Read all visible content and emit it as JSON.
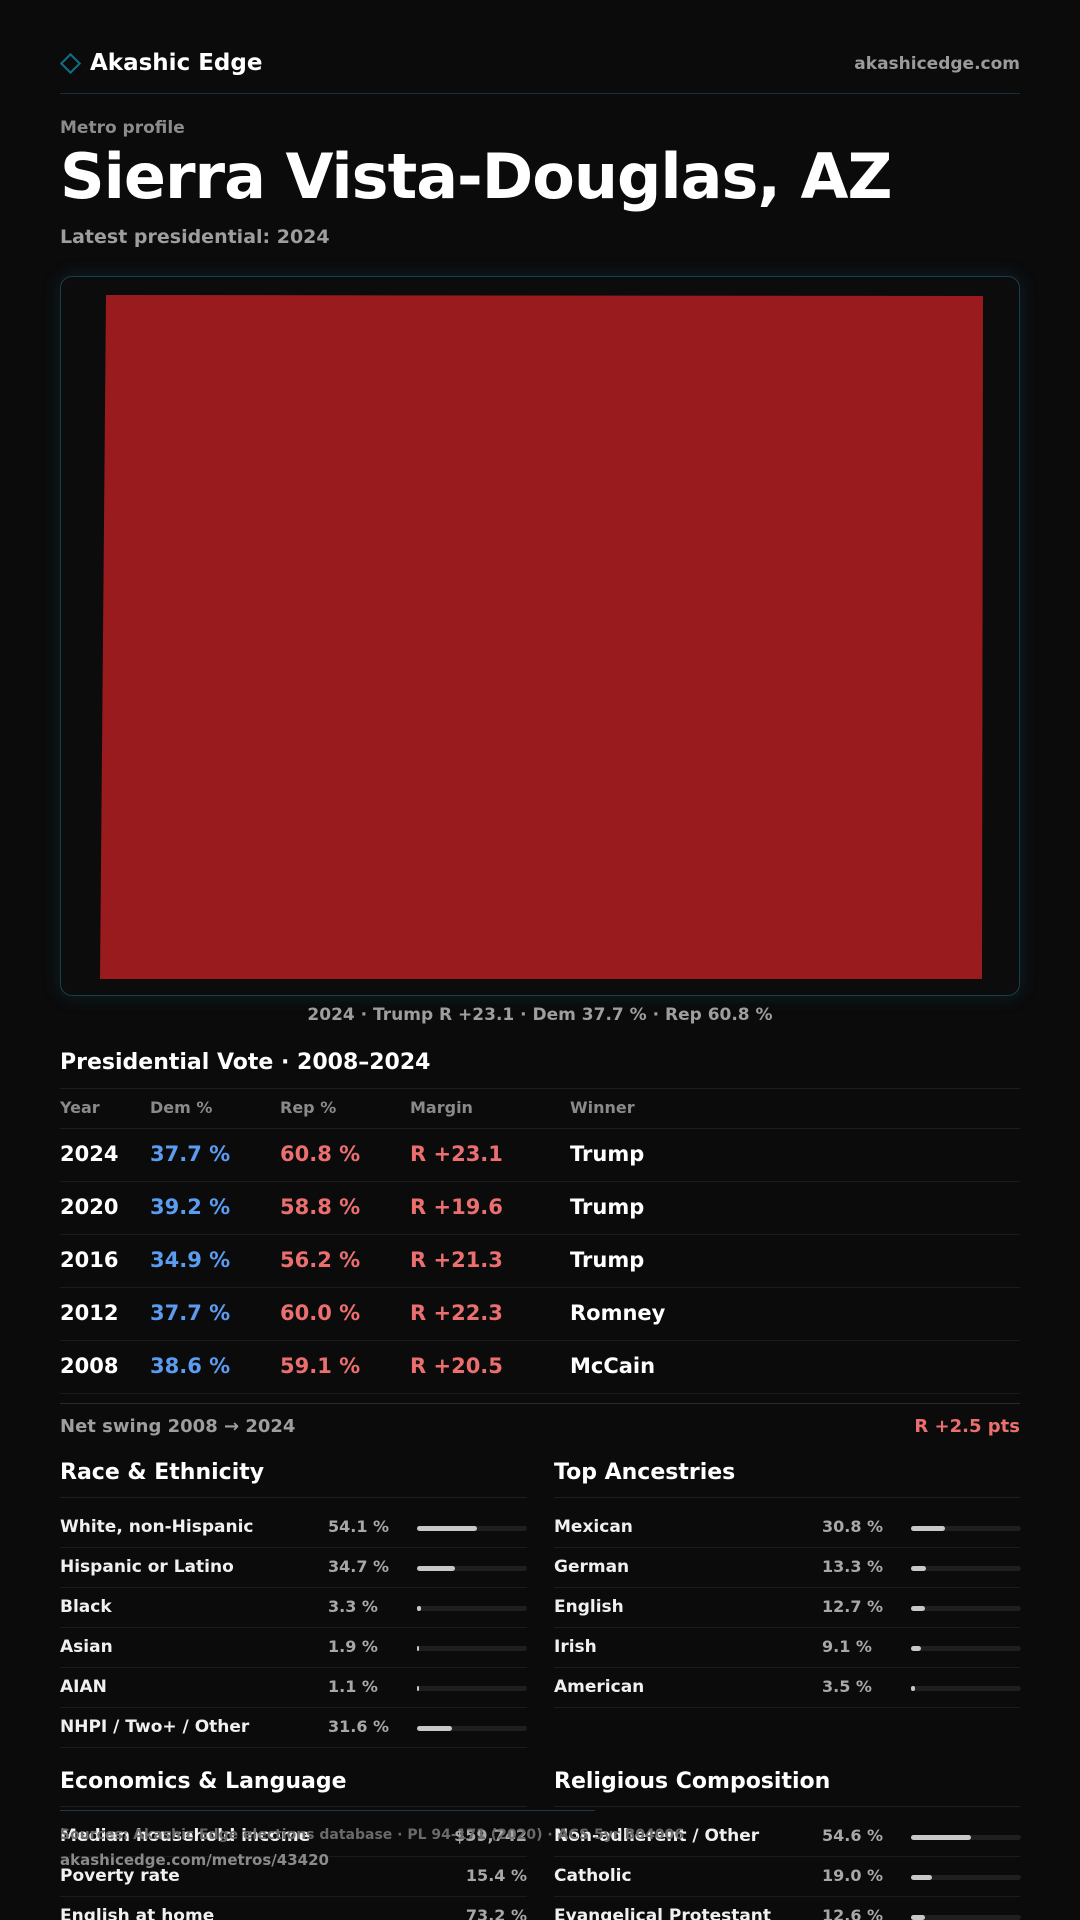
{
  "header": {
    "brand": "Akashic Edge",
    "site": "akashicedge.com",
    "brand_icon": "diamond-icon"
  },
  "profile": {
    "eyebrow": "Metro profile",
    "title": "Sierra Vista-Douglas, AZ",
    "subtitle": "Latest presidential: 2024"
  },
  "map": {
    "caption": "2024 · Trump R +23.1 · Dem 37.7 % · Rep 60.8 %",
    "fill_color": "#9a1b1e"
  },
  "presidential": {
    "title": "Presidential Vote · 2008–2024",
    "columns": [
      "Year",
      "Dem %",
      "Rep %",
      "Margin",
      "Winner"
    ],
    "rows": [
      {
        "year": "2024",
        "dem": "37.7 %",
        "rep": "60.8 %",
        "margin": "R +23.1",
        "winner": "Trump"
      },
      {
        "year": "2020",
        "dem": "39.2 %",
        "rep": "58.8 %",
        "margin": "R +19.6",
        "winner": "Trump"
      },
      {
        "year": "2016",
        "dem": "34.9 %",
        "rep": "56.2 %",
        "margin": "R +21.3",
        "winner": "Trump"
      },
      {
        "year": "2012",
        "dem": "37.7 %",
        "rep": "60.0 %",
        "margin": "R +22.3",
        "winner": "Romney"
      },
      {
        "year": "2008",
        "dem": "38.6 %",
        "rep": "59.1 %",
        "margin": "R +20.5",
        "winner": "McCain"
      }
    ],
    "swing_label": "Net swing 2008 → 2024",
    "swing_value": "R +2.5 pts"
  },
  "race": {
    "title": "Race & Ethnicity",
    "items": [
      {
        "label": "White, non-Hispanic",
        "value": "54.1 %",
        "pct": 54.1
      },
      {
        "label": "Hispanic or Latino",
        "value": "34.7 %",
        "pct": 34.7
      },
      {
        "label": "Black",
        "value": "3.3 %",
        "pct": 3.3
      },
      {
        "label": "Asian",
        "value": "1.9 %",
        "pct": 1.9
      },
      {
        "label": "AIAN",
        "value": "1.1 %",
        "pct": 1.1
      },
      {
        "label": "NHPI / Two+ / Other",
        "value": "31.6 %",
        "pct": 31.6
      }
    ]
  },
  "ancestry": {
    "title": "Top Ancestries",
    "items": [
      {
        "label": "Mexican",
        "value": "30.8 %",
        "pct": 30.8
      },
      {
        "label": "German",
        "value": "13.3 %",
        "pct": 13.3
      },
      {
        "label": "English",
        "value": "12.7 %",
        "pct": 12.7
      },
      {
        "label": "Irish",
        "value": "9.1 %",
        "pct": 9.1
      },
      {
        "label": "American",
        "value": "3.5 %",
        "pct": 3.5
      }
    ]
  },
  "economics": {
    "title": "Economics & Language",
    "items": [
      {
        "label": "Median household income",
        "value": "$59,742"
      },
      {
        "label": "Poverty rate",
        "value": "15.4 %"
      },
      {
        "label": "English at home",
        "value": "73.2 %"
      }
    ]
  },
  "religion": {
    "title": "Religious Composition",
    "items": [
      {
        "label": "Non-adherent / Other",
        "value": "54.6 %",
        "pct": 54.6
      },
      {
        "label": "Catholic",
        "value": "19.0 %",
        "pct": 19.0
      },
      {
        "label": "Evangelical Protestant",
        "value": "12.6 %",
        "pct": 12.6
      }
    ]
  },
  "footer": {
    "source": "Sources: Akashic Edge elections database · PL 94-171 (2020) · ACS 5yr B04006",
    "url": "akashicedge.com/metros/43420"
  },
  "colors": {
    "accent": "#0f6f86",
    "dem": "#5b9cf0",
    "rep": "#ec6f6f"
  }
}
